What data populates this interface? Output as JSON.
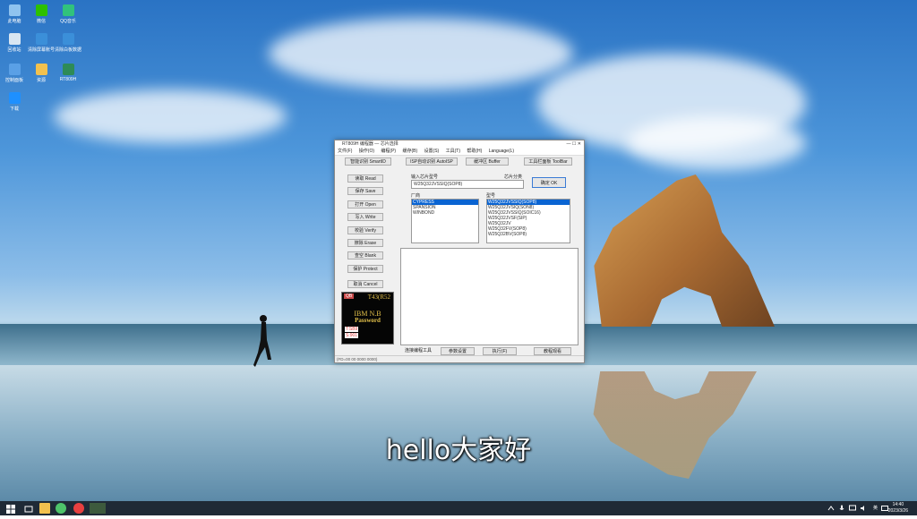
{
  "desktop": {
    "icons": [
      {
        "label": "此电脑",
        "color": "#8fc3ef"
      },
      {
        "label": "微信",
        "color": "#2dc100"
      },
      {
        "label": "QQ音乐",
        "color": "#31c27c"
      },
      {
        "label": "回收站",
        "color": "#d9e6f2"
      },
      {
        "label": "清除屏幕账号",
        "color": "#3b8fd9"
      },
      {
        "label": "清除白板数据",
        "color": "#3b8fd9"
      },
      {
        "label": "控制面板",
        "color": "#5aa0e6"
      },
      {
        "label": "资源",
        "color": "#f2c14e"
      },
      {
        "label": "RT809H",
        "color": "#2e8b57"
      },
      {
        "label": "下载",
        "color": "#1e90ff"
      }
    ]
  },
  "window": {
    "title": "RT809H 编程器 — 芯片选择",
    "menu": [
      "文件(F)",
      "操作(O)",
      "编程(P)",
      "缓存(B)",
      "设置(S)",
      "工具(T)",
      "帮助(H)",
      "Language(L)"
    ],
    "toolbar": {
      "smart_id": "智能识别 SmartID",
      "isp_auto": "ISP自动识别 AutoISP",
      "buffer": "缓冲区 Buffer",
      "toolbar_btn": "工具栏面板 ToolBar"
    },
    "side_buttons": [
      "读取 Read",
      "保存 Save",
      "打开 Open",
      "写入 Write",
      "校验 Verify",
      "擦除 Erase",
      "查空 Blank",
      "保护 Protect",
      "取消 Cancel"
    ],
    "chip_input_label": "输入芯片型号",
    "chip_input_value": "W25Q32JVSSIQ(SOP8)",
    "chip_select_label": "芯片分类",
    "confirm": "确定 OK",
    "manufacturer_label": "厂商",
    "manufacturers": [
      "CYPRESS",
      "SPANSION",
      "WINBOND"
    ],
    "model_label": "型号",
    "models": [
      "W25Q32JVSSIQ(SOP8)",
      "W25Q32JVSIQ(SON8)",
      "W25Q32JVSSIQ(SOIC16)",
      "W25Q32JVSF(SIP)",
      "W25Q32JV",
      "W25Q32FV(SOP8)",
      "W25Q32BV(SOP8)"
    ],
    "bottom_buttons": [
      "连接编程工具",
      "参数设置",
      "执行(F)",
      "教程观看"
    ],
    "status": "(FD=00 00 0000 0000)",
    "ibm_panel": {
      "badge": "QB",
      "code": "T43(R52",
      "line1": "IBM  N.B",
      "line2": "Password",
      "line3": "T:SB9",
      "line4": "S:901"
    }
  },
  "subtitle": "hello大家好",
  "taskbar": {
    "clock_time": "14:40",
    "clock_date": "2023/3/26",
    "ime": "英"
  }
}
